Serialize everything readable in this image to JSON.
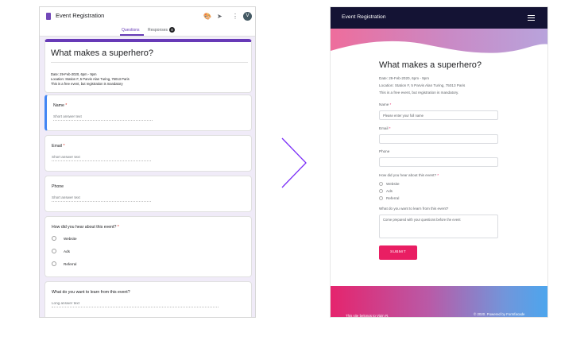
{
  "editor": {
    "app_title": "Event Registration",
    "avatar_initial": "V",
    "tabs": [
      {
        "label": "Questions",
        "active": true
      },
      {
        "label": "Responses",
        "active": false,
        "badge": "8"
      }
    ],
    "form_title": "What makes a superhero?",
    "description_lines": [
      "Date: 29-Feb-2020, 6pm - 9pm",
      "Location: Station F, 5 Parvis Alan Turing, 75013 Paris",
      "This is a free event, but registration is mandatory"
    ],
    "questions": [
      {
        "label": "Name",
        "required": "*",
        "placeholder": "Short answer text"
      },
      {
        "label": "Email",
        "required": "*",
        "placeholder": "Short answer text"
      },
      {
        "label": "Phone",
        "required": "",
        "placeholder": "Short answer text"
      },
      {
        "label": "How did you hear about this event?",
        "required": "*",
        "options": [
          "Website",
          "Ads",
          "Referral"
        ]
      },
      {
        "label": "What do you want to learn from this event?",
        "required": "",
        "placeholder": "Long answer text"
      }
    ],
    "accent_color": "#673ab7",
    "background_color": "#f0ebf8"
  },
  "published": {
    "nav_title": "Event Registration",
    "menu_icon": "hamburger-menu-icon",
    "form_title": "What makes a superhero?",
    "description_lines": [
      "Date: 29-Feb-2020, 6pm - 9pm",
      "Location: Station F, 5 Parvis Alan Turing, 75013 Paris",
      "This is a free event, but registration is mandatory."
    ],
    "fields": [
      {
        "label": "Name",
        "required": "*",
        "placeholder": "Please enter your full name"
      },
      {
        "label": "Email",
        "required": "*",
        "placeholder": ""
      },
      {
        "label": "Phone",
        "required": "",
        "placeholder": ""
      },
      {
        "label": "How did you hear about this event?",
        "required": "*",
        "options": [
          "Website",
          "Ads",
          "Referral"
        ]
      },
      {
        "label": "What do you want to learn from this event?",
        "required": "",
        "placeholder": "Come prepared with your questions before the event"
      }
    ],
    "submit_label": "SUBMIT",
    "footer_left": "This site belongs to Vipin R.",
    "footer_right": "© 2020. Powered by Formfacade",
    "nav_color": "#141334",
    "submit_color": "#e91e63"
  },
  "arrow_icon": "chevron-right-icon",
  "arrow_color": "#7b2ff7"
}
